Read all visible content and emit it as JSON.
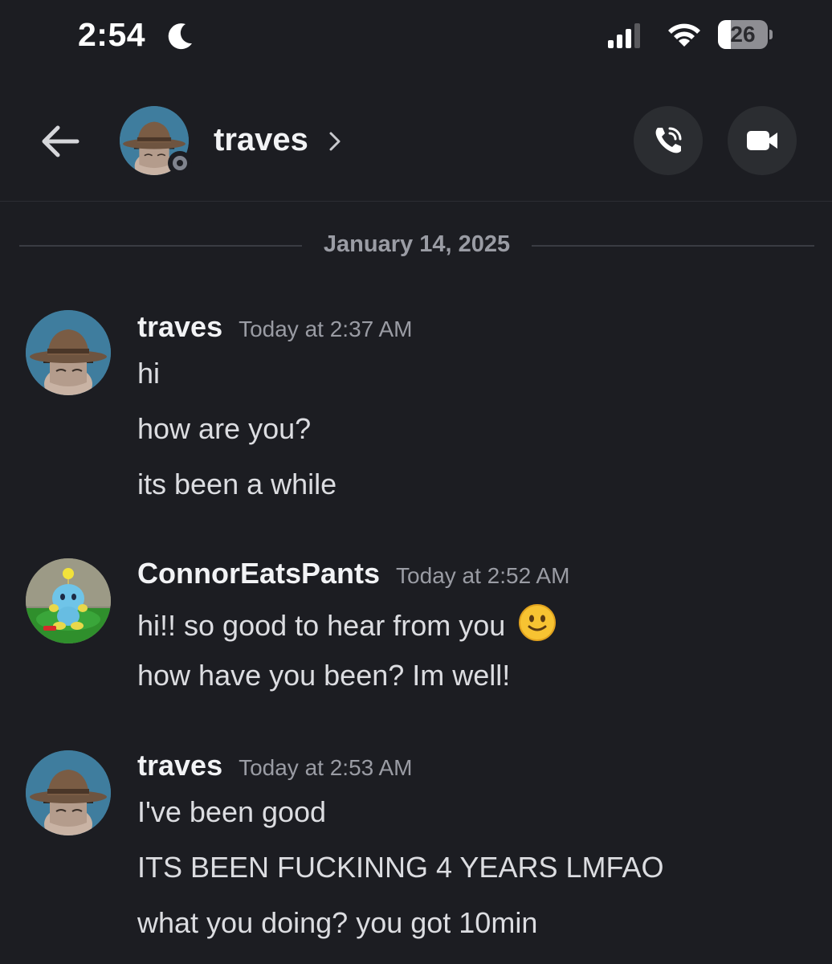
{
  "status_bar": {
    "time": "2:54",
    "battery": "26",
    "battery_level": 0.26
  },
  "header": {
    "contact_name": "traves"
  },
  "date_divider": "January 14, 2025",
  "messages": [
    {
      "author": "traves",
      "timestamp": "Today at 2:37 AM",
      "lines": [
        "hi",
        "how are you?",
        "its been a while"
      ]
    },
    {
      "author": "ConnorEatsPants",
      "timestamp": "Today at 2:52 AM",
      "lines": [
        "hi!! so good to hear from you",
        "how have you been? Im well!"
      ],
      "emoji": "slightly-smiling-face"
    },
    {
      "author": "traves",
      "timestamp": "Today at 2:53 AM",
      "lines": [
        "I've been good",
        "ITS BEEN FUCKINNG 4 YEARS LMFAO",
        "what you doing? you got 10min"
      ]
    }
  ],
  "icons": {
    "moon": "moon-icon",
    "signal": "cellular-signal-icon",
    "wifi": "wifi-icon",
    "back": "arrow-left-icon",
    "chevron": "chevron-right-icon",
    "call": "phone-call-icon",
    "video": "video-camera-icon"
  },
  "colors": {
    "background": "#1c1d22",
    "button_background": "#2b2d31",
    "muted_text": "#9a9ca4",
    "offline_status": "#80848e"
  }
}
